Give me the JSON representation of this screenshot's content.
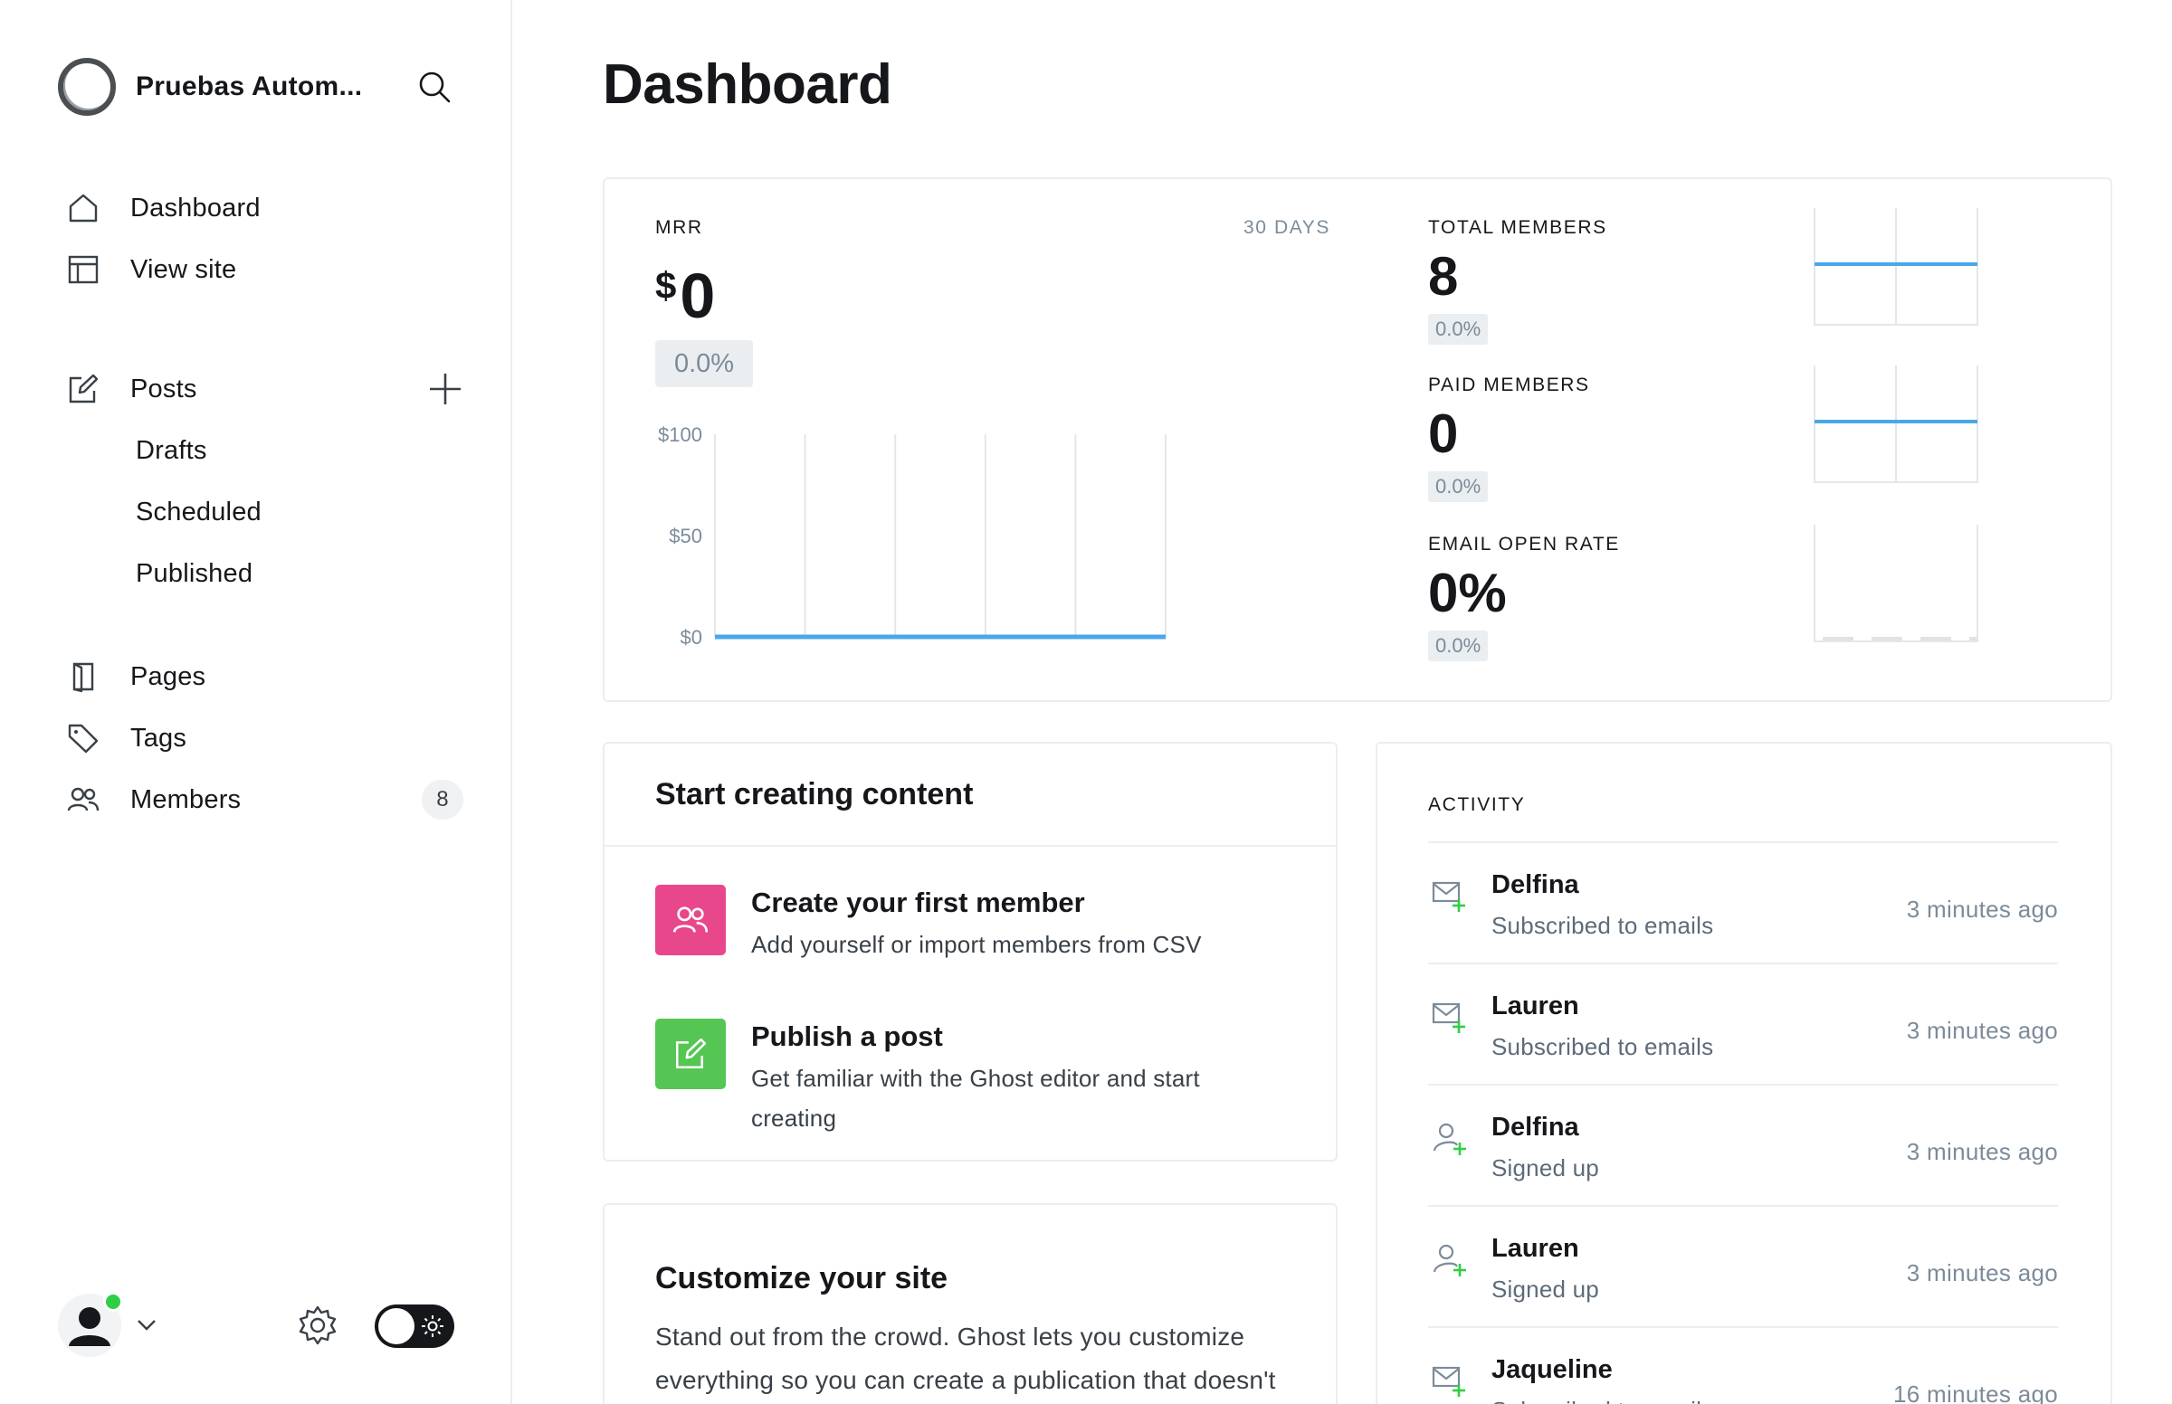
{
  "site": {
    "title": "Pruebas Autom..."
  },
  "nav": {
    "dashboard": "Dashboard",
    "view_site": "View site",
    "posts": "Posts",
    "drafts": "Drafts",
    "scheduled": "Scheduled",
    "published": "Published",
    "pages": "Pages",
    "tags": "Tags",
    "members": "Members",
    "members_count": "8"
  },
  "page_title": "Dashboard",
  "kpis": {
    "mrr": {
      "label": "MRR",
      "range": "30 DAYS",
      "currency": "$",
      "value": "0",
      "delta": "0.0%",
      "chart_data": {
        "type": "line",
        "ylim": [
          0,
          100
        ],
        "ytick_labels": [
          "$100",
          "$50",
          "$0"
        ],
        "series": [
          {
            "values": [
              0,
              0,
              0,
              0,
              0,
              0
            ]
          }
        ],
        "color": "#4aa8ea"
      }
    },
    "total_members": {
      "label": "TOTAL MEMBERS",
      "value": "8",
      "delta": "0.0%"
    },
    "paid_members": {
      "label": "PAID MEMBERS",
      "value": "0",
      "delta": "0.0%"
    },
    "email_open_rate": {
      "label": "EMAIL OPEN RATE",
      "value": "0%",
      "delta": "0.0%"
    }
  },
  "start": {
    "title": "Start creating content",
    "items": [
      {
        "title": "Create your first member",
        "desc": "Add yourself or import members from CSV",
        "icon": "members-icon",
        "color": "#e9478b"
      },
      {
        "title": "Publish a post",
        "desc": "Get familiar with the Ghost editor and start creating",
        "icon": "edit-icon",
        "color": "#55c553"
      }
    ]
  },
  "customize": {
    "title": "Customize your site",
    "desc": "Stand out from the crowd. Ghost lets you customize everything so you can create a publication that doesn't just look the same as what"
  },
  "activity": {
    "label": "ACTIVITY",
    "items": [
      {
        "name": "Delfina",
        "desc": "Subscribed to emails",
        "time": "3 minutes ago",
        "icon": "email-plus-icon"
      },
      {
        "name": "Lauren",
        "desc": "Subscribed to emails",
        "time": "3 minutes ago",
        "icon": "email-plus-icon"
      },
      {
        "name": "Delfina",
        "desc": "Signed up",
        "time": "3 minutes ago",
        "icon": "user-plus-icon"
      },
      {
        "name": "Lauren",
        "desc": "Signed up",
        "time": "3 minutes ago",
        "icon": "user-plus-icon"
      },
      {
        "name": "Jaqueline",
        "desc": "Subscribed to emails",
        "time": "16 minutes ago",
        "icon": "email-plus-icon"
      }
    ]
  },
  "colors": {
    "accent_blue": "#4aa8ea",
    "online_green": "#30cf43",
    "member_pink": "#e9478b",
    "post_green": "#55c553"
  }
}
